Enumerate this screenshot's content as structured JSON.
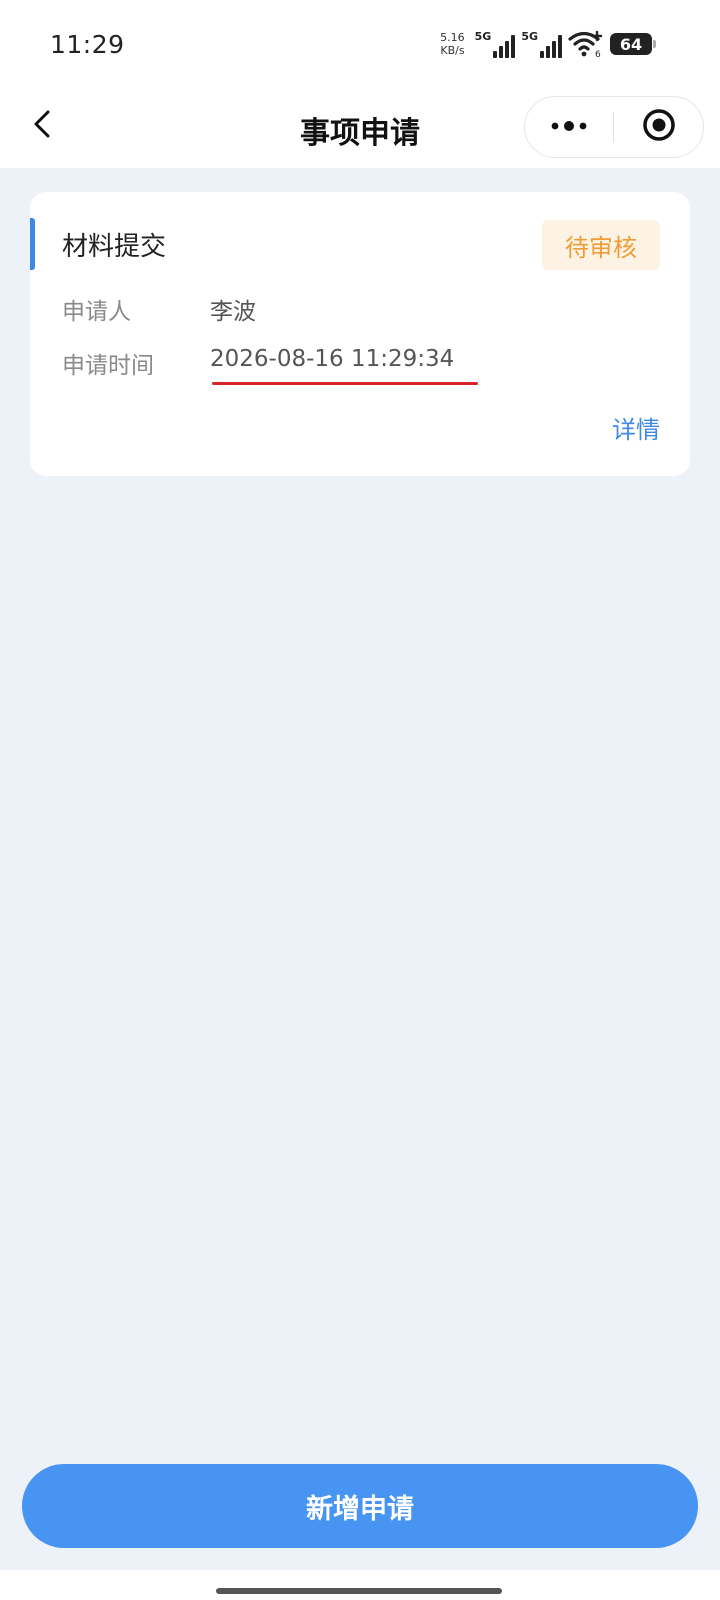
{
  "status_bar": {
    "time": "11:29",
    "net_speed_value": "5.16",
    "net_speed_unit": "KB/s",
    "signal1_label": "5G",
    "signal2_label": "5G",
    "wifi_sub": "6",
    "battery": "64"
  },
  "nav": {
    "title": "事项申请",
    "back_icon": "chevron-left-icon",
    "more_icon": "more-dots-icon",
    "close_icon": "target-circle-icon"
  },
  "card": {
    "title": "材料提交",
    "status": "待审核",
    "applicant_label": "申请人",
    "applicant_value": "李波",
    "time_label": "申请时间",
    "time_value": "2026-08-16 11:29:34",
    "detail_link": "详情"
  },
  "bottom": {
    "primary_button": "新增申请"
  },
  "colors": {
    "accent": "#3f8ae6",
    "button": "#4794f2",
    "status_pending_text": "#ef9d35",
    "status_pending_bg": "#fdf3e5",
    "page_bg": "#edf1f8",
    "underline": "#d8252b"
  }
}
